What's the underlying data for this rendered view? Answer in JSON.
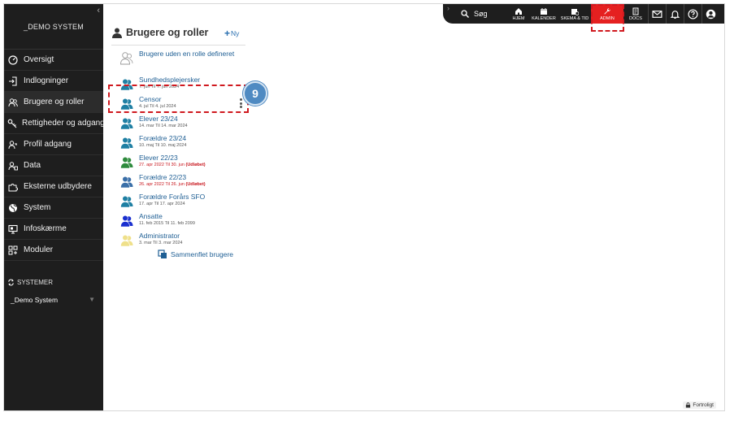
{
  "sidebar": {
    "brand": "_DEMO SYSTEM",
    "items": [
      {
        "label": "Oversigt",
        "icon": "speedometer-icon"
      },
      {
        "label": "Indlogninger",
        "icon": "login-icon"
      },
      {
        "label": "Brugere og roller",
        "icon": "users-icon"
      },
      {
        "label": "Rettigheder og adgang",
        "icon": "key-icon"
      },
      {
        "label": "Profil adgang",
        "icon": "profile-key-icon"
      },
      {
        "label": "Data",
        "icon": "data-users-icon"
      },
      {
        "label": "Eksterne udbydere",
        "icon": "puzzle-icon"
      },
      {
        "label": "System",
        "icon": "globe-icon"
      },
      {
        "label": "Infoskærme",
        "icon": "monitor-icon"
      },
      {
        "label": "Moduler",
        "icon": "modules-icon"
      }
    ],
    "systems_header": "SYSTEMER",
    "system_selected": "_Demo System"
  },
  "topbar": {
    "search_label": "Søg",
    "home": "HJEM",
    "calendar": "KALENDER",
    "schedule": "SKEMA & TID",
    "admin": "ADMIN",
    "docs": "DOCS"
  },
  "step_badge": "9",
  "page": {
    "title": "Brugere og roller",
    "new_label": "Ny",
    "merge_label": "Sammenflet brugere",
    "privacy_label": "Fortroligt"
  },
  "roles": [
    {
      "name": "Brugere uden en rolle defineret",
      "date": "",
      "color": "#ffffff",
      "outline": true
    },
    {
      "name": "Sundhedsplejersker",
      "date": "7. jun Til 7. jun 2024",
      "color": "#1e7fa3"
    },
    {
      "name": "Censor",
      "date": "4. jul Til 4. jul 2024",
      "color": "#1e7fa3"
    },
    {
      "name": "Elever 23/24",
      "date": "14. mar Til 14. mar 2024",
      "color": "#1e7fa3"
    },
    {
      "name": "Forældre 23/24",
      "date": "10. maj Til 10. maj 2024",
      "color": "#1e7fa3"
    },
    {
      "name": "Elever 22/23",
      "date": "27. apr 2022 Til 30. jun",
      "expired": "(Udløbet)",
      "color": "#2e8b3d"
    },
    {
      "name": "Forældre 22/23",
      "date": "26. apr 2022 Til 26. jun",
      "expired": "(Udløbet)",
      "color": "#3a6fa8"
    },
    {
      "name": "Forældre Forårs SFO",
      "date": "17. apr Til 17. apr 2024",
      "color": "#1e7fa3"
    },
    {
      "name": "Ansatte",
      "date": "11. feb 2015 Til 11. feb 2099",
      "color": "#1a2fcf"
    },
    {
      "name": "Administrator",
      "date": "3. mar Til 3. mar 2024",
      "color": "#efe08a"
    }
  ]
}
